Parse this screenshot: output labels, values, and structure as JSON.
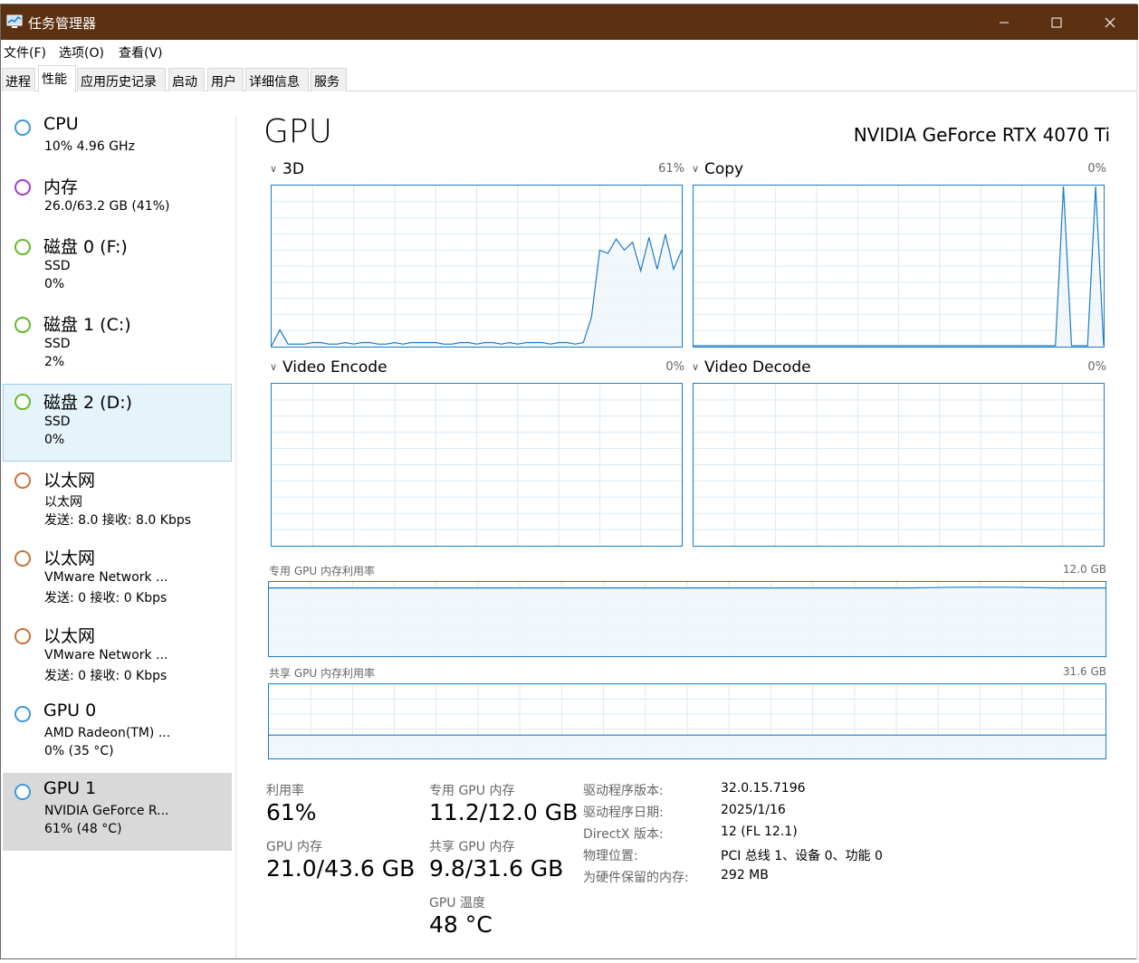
{
  "window": {
    "title": "任务管理器"
  },
  "menu": [
    "文件(F)",
    "选项(O)",
    "查看(V)"
  ],
  "tabs": [
    "进程",
    "性能",
    "应用历史记录",
    "启动",
    "用户",
    "详细信息",
    "服务"
  ],
  "sidebar": [
    {
      "name": "CPU",
      "line2": "10% 4.96 GHz",
      "line3": "",
      "color": "#3c9ad6"
    },
    {
      "name": "内存",
      "line2": "26.0/63.2 GB (41%)",
      "line3": "",
      "color": "#a53cc4"
    },
    {
      "name": "磁盘 0 (F:)",
      "line2": "SSD",
      "line3": "0%",
      "color": "#66b82a"
    },
    {
      "name": "磁盘 1 (C:)",
      "line2": "SSD",
      "line3": "2%",
      "color": "#66b82a"
    },
    {
      "name": "磁盘 2 (D:)",
      "line2": "SSD",
      "line3": "0%",
      "color": "#66b82a"
    },
    {
      "name": "以太网",
      "line2": "以太网",
      "line3": "发送: 8.0 接收: 8.0 Kbps",
      "color": "#c8743a"
    },
    {
      "name": "以太网",
      "line2": "VMware Network ...",
      "line3": "发送: 0 接收: 0 Kbps",
      "color": "#c8743a"
    },
    {
      "name": "以太网",
      "line2": "VMware Network ...",
      "line3": "发送: 0 接收: 0 Kbps",
      "color": "#c8743a"
    },
    {
      "name": "GPU 0",
      "line2": "AMD Radeon(TM) ...",
      "line3": "0% (35 °C)",
      "color": "#3c9ad6"
    },
    {
      "name": "GPU 1",
      "line2": "NVIDIA GeForce R...",
      "line3": "61% (48 °C)",
      "color": "#3c9ad6"
    }
  ],
  "main": {
    "title": "GPU",
    "model": "NVIDIA GeForce RTX 4070 Ti",
    "graphs": [
      {
        "label": "3D",
        "pct": "61%"
      },
      {
        "label": "Copy",
        "pct": "0%"
      },
      {
        "label": "Video Encode",
        "pct": "0%"
      },
      {
        "label": "Video Decode",
        "pct": "0%"
      }
    ],
    "dedicated_mem": {
      "label": "专用 GPU 内存利用率",
      "total": "12.0 GB"
    },
    "shared_mem": {
      "label": "共享 GPU 内存利用率",
      "total": "31.6 GB"
    },
    "stats": {
      "util_label": "利用率",
      "util_value": "61%",
      "gpumem_label": "GPU 内存",
      "gpumem_value": "21.0/43.6 GB",
      "ded_label": "专用 GPU 内存",
      "ded_value": "11.2/12.0 GB",
      "shared_label": "共享 GPU 内存",
      "shared_value": "9.8/31.6 GB",
      "temp_label": "GPU 温度",
      "temp_value": "48 °C"
    },
    "info": [
      {
        "key": "驱动程序版本:",
        "value": "32.0.15.7196"
      },
      {
        "key": "驱动程序日期:",
        "value": "2025/1/16"
      },
      {
        "key": "DirectX 版本:",
        "value": "12 (FL 12.1)"
      },
      {
        "key": "物理位置:",
        "value": "PCI 总线 1、设备 0、功能 0"
      },
      {
        "key": "为硬件保留的内存:",
        "value": "292 MB"
      }
    ]
  },
  "chart_data": [
    {
      "type": "area",
      "series": [
        {
          "values": [
            0,
            10,
            1,
            1,
            1,
            2,
            2,
            1,
            1,
            2,
            1,
            2,
            2,
            1,
            1,
            2,
            1,
            2,
            2,
            2,
            2,
            1,
            1,
            2,
            2,
            1,
            2,
            2,
            1,
            2,
            1,
            2,
            2,
            2,
            1,
            2,
            2,
            1,
            2,
            18,
            60,
            58,
            67,
            60,
            65,
            47,
            68,
            48,
            70,
            48,
            60
          ]
        }
      ],
      "ylim": [
        0,
        100
      ]
    },
    {
      "type": "line",
      "series": [
        {
          "values": [
            0,
            0,
            0,
            0,
            0,
            0,
            0,
            0,
            0,
            0,
            0,
            0,
            0,
            0,
            0,
            0,
            0,
            0,
            0,
            0,
            0,
            0,
            0,
            0,
            0,
            0,
            0,
            0,
            0,
            0,
            0,
            0,
            0,
            0,
            0,
            0,
            0,
            0,
            0,
            0,
            0,
            0,
            0,
            0,
            0,
            0,
            100,
            0,
            0,
            0,
            100,
            0
          ]
        }
      ],
      "ylim": [
        0,
        100
      ]
    },
    {
      "type": "line",
      "series": [
        {
          "values": []
        }
      ],
      "ylim": [
        0,
        100
      ]
    },
    {
      "type": "line",
      "series": [
        {
          "values": []
        }
      ],
      "ylim": [
        0,
        100
      ]
    },
    {
      "type": "area",
      "series": [
        {
          "values": [
            93,
            93,
            93,
            93,
            93,
            93,
            93,
            93,
            93,
            93,
            93,
            93,
            93,
            93,
            94,
            94,
            93,
            93
          ]
        }
      ],
      "ylim": [
        0,
        100
      ]
    },
    {
      "type": "area",
      "series": [
        {
          "values": [
            31,
            31,
            31,
            31,
            31,
            31,
            31,
            31,
            31,
            31
          ]
        }
      ],
      "ylim": [
        0,
        100
      ]
    }
  ],
  "colors": {
    "titlebar": "#5c3112",
    "graph_line": "#1a7cc4",
    "graph_fill": "#f1f6fb",
    "grid": "#d9eaf7",
    "selected_blue": "#e5f3fb",
    "selected_gray": "#d9d9d9"
  }
}
